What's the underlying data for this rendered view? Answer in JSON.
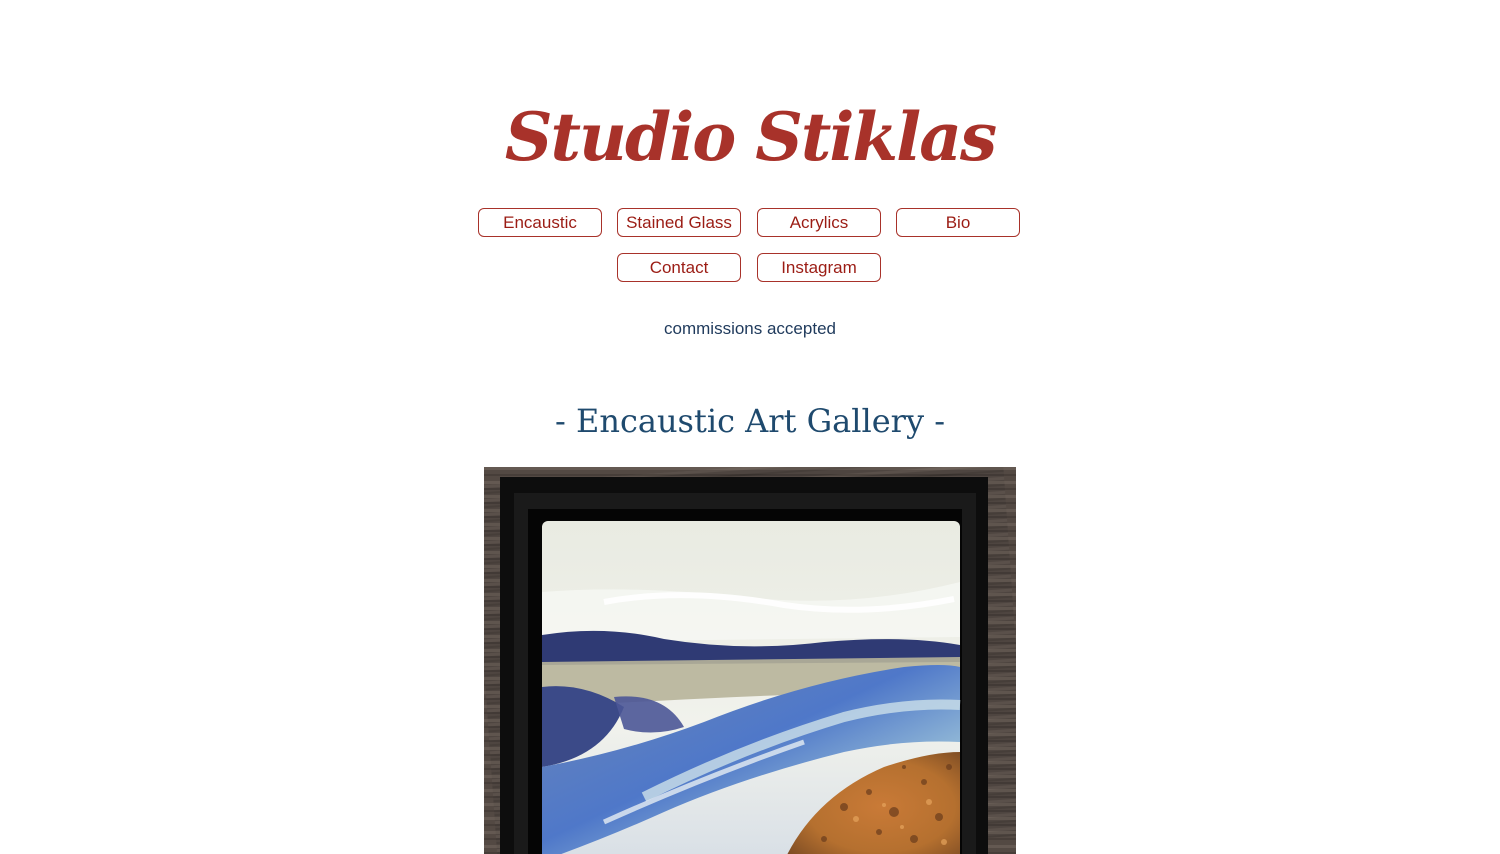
{
  "header": {
    "title": "Studio Stiklas",
    "title_color": "#a8322a"
  },
  "nav": {
    "items": [
      {
        "label": "Encaustic"
      },
      {
        "label": "Stained Glass"
      },
      {
        "label": "Acrylics"
      },
      {
        "label": "Bio"
      },
      {
        "label": "Contact"
      },
      {
        "label": "Instagram"
      }
    ],
    "border_color": "#a8322a"
  },
  "tagline": "commissions accepted",
  "gallery": {
    "heading": "- Encaustic Art Gallery -",
    "heading_color": "#1f4a6e"
  }
}
